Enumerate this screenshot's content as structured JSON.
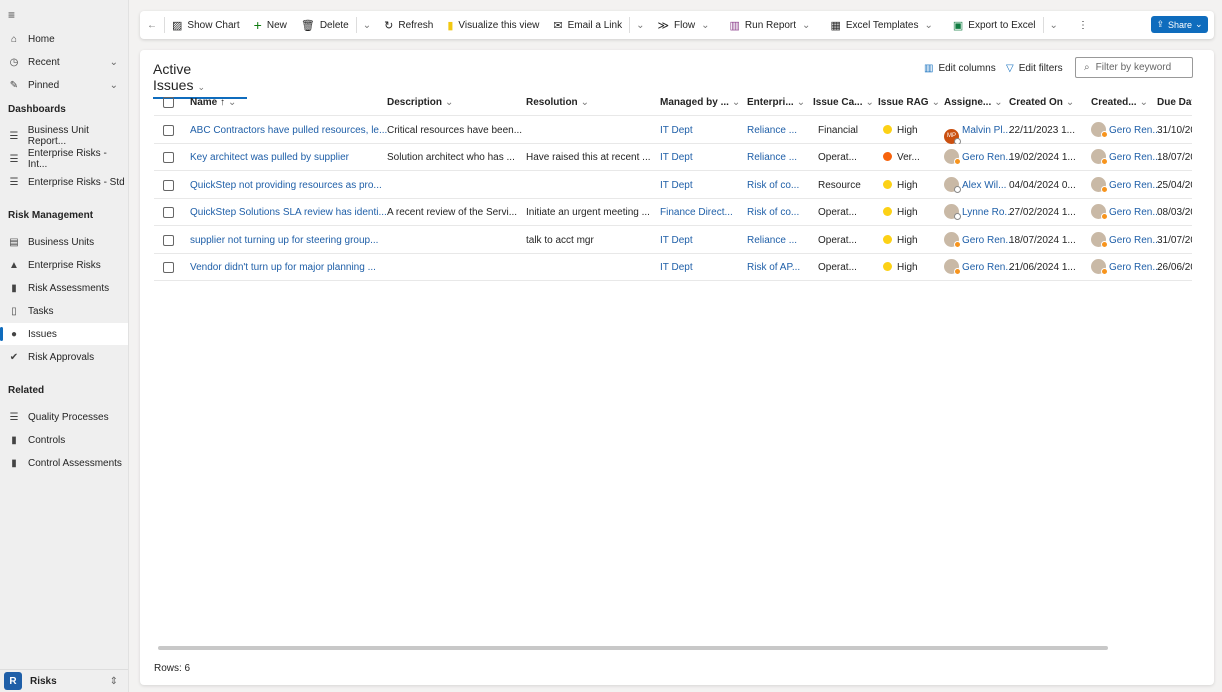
{
  "sidebar": {
    "top": [
      {
        "label": "Home",
        "icon": "home-icon"
      },
      {
        "label": "Recent",
        "icon": "clock-icon"
      },
      {
        "label": "Pinned",
        "icon": "pin-icon"
      }
    ],
    "sections": [
      {
        "title": "Dashboards",
        "items": [
          {
            "label": "Business Unit Report...",
            "icon": "dashboard-icon"
          },
          {
            "label": "Enterprise Risks - Int...",
            "icon": "dashboard-icon"
          },
          {
            "label": "Enterprise Risks - Std",
            "icon": "dashboard-icon"
          }
        ]
      },
      {
        "title": "Risk Management",
        "items": [
          {
            "label": "Business Units",
            "icon": "building-icon"
          },
          {
            "label": "Enterprise Risks",
            "icon": "warning-icon"
          },
          {
            "label": "Risk Assessments",
            "icon": "clipboard-icon"
          },
          {
            "label": "Tasks",
            "icon": "task-icon"
          },
          {
            "label": "Issues",
            "icon": "issue-icon",
            "active": true
          },
          {
            "label": "Risk Approvals",
            "icon": "check-circle-icon"
          }
        ]
      },
      {
        "title": "Related",
        "items": [
          {
            "label": "Quality Processes",
            "icon": "process-icon"
          },
          {
            "label": "Controls",
            "icon": "clipboard-icon"
          },
          {
            "label": "Control Assessments",
            "icon": "clipboard-icon"
          }
        ]
      }
    ],
    "area": {
      "badge": "R",
      "label": "Risks"
    }
  },
  "toolbar": {
    "show_chart": "Show Chart",
    "new": "New",
    "delete": "Delete",
    "refresh": "Refresh",
    "visualize": "Visualize this view",
    "email": "Email a Link",
    "flow": "Flow",
    "run_report": "Run Report",
    "excel_templates": "Excel Templates",
    "export": "Export to Excel",
    "share": "Share"
  },
  "view": {
    "title": "Active Issues",
    "edit_columns": "Edit columns",
    "edit_filters": "Edit filters",
    "search_placeholder": "Filter by keyword",
    "rows_label": "Rows: 6"
  },
  "colors": {
    "accent": "#0f6cbd",
    "rag_high": "#fcd116",
    "rag_very_high": "#f7630c"
  },
  "columns": [
    "Name ↑",
    "Description",
    "Resolution",
    "Managed by ...",
    "Enterpri...",
    "Issue Ca...",
    "Issue RAG",
    "Assigne...",
    "Created On",
    "Created...",
    "Due Date"
  ],
  "rows": [
    {
      "name": "ABC Contractors have pulled resources, le...",
      "description": "Critical resources have been...",
      "resolution": "",
      "managed": "IT Dept",
      "enterprise": "Reliance ...",
      "category": "Financial",
      "rag": "High",
      "rag_color": "#fcd116",
      "assignee": "Malvin Pl...",
      "assignee_initials": "MP",
      "created_on": "22/11/2023 1...",
      "created_by": "Gero Ren...",
      "due": "31/10/20"
    },
    {
      "name": "Key architect was pulled by supplier",
      "description": "Solution architect who has ...",
      "resolution": "Have raised this at recent ...",
      "managed": "IT Dept",
      "enterprise": "Reliance ...",
      "category": "Operat...",
      "rag": "Ver...",
      "rag_color": "#f7630c",
      "assignee": "Gero Ren...",
      "assignee_initials": "",
      "created_on": "19/02/2024 1...",
      "created_by": "Gero Ren...",
      "due": "18/07/20"
    },
    {
      "name": "QuickStep not providing resources as pro...",
      "description": "",
      "resolution": "",
      "managed": "IT Dept",
      "enterprise": "Risk of co...",
      "category": "Resource",
      "rag": "High",
      "rag_color": "#fcd116",
      "assignee": "Alex Wil...",
      "assignee_initials": "",
      "created_on": "04/04/2024 0...",
      "created_by": "Gero Ren...",
      "due": "25/04/20"
    },
    {
      "name": "QuickStep Solutions SLA review has identi...",
      "description": "A recent review of the Servi...",
      "resolution": "Initiate an urgent meeting ...",
      "managed": "Finance Direct...",
      "enterprise": "Risk of co...",
      "category": "Operat...",
      "rag": "High",
      "rag_color": "#fcd116",
      "assignee": "Lynne Ro...",
      "assignee_initials": "",
      "created_on": "27/02/2024 1...",
      "created_by": "Gero Ren...",
      "due": "08/03/20"
    },
    {
      "name": "supplier not turning up for steering group...",
      "description": "",
      "resolution": "talk to acct mgr",
      "managed": "IT Dept",
      "enterprise": "Reliance ...",
      "category": "Operat...",
      "rag": "High",
      "rag_color": "#fcd116",
      "assignee": "Gero Ren...",
      "assignee_initials": "",
      "created_on": "18/07/2024 1...",
      "created_by": "Gero Ren...",
      "due": "31/07/20"
    },
    {
      "name": "Vendor didn't turn up for major planning ...",
      "description": "",
      "resolution": "",
      "managed": "IT Dept",
      "enterprise": "Risk of AP...",
      "category": "Operat...",
      "rag": "High",
      "rag_color": "#fcd116",
      "assignee": "Gero Ren...",
      "assignee_initials": "",
      "created_on": "21/06/2024 1...",
      "created_by": "Gero Ren...",
      "due": "26/06/20"
    }
  ]
}
